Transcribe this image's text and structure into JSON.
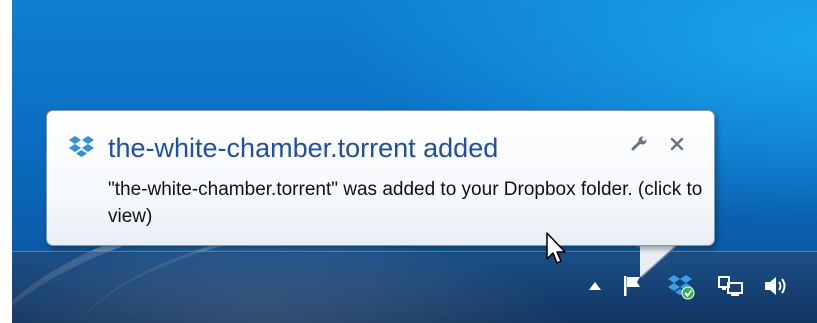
{
  "notification": {
    "app_icon": "dropbox-icon",
    "title": "the-white-chamber.torrent added",
    "body": "\"the-white-chamber.torrent\" was added to your Dropbox folder. (click to view)",
    "options_icon": "wrench-icon",
    "close_icon": "close-icon"
  },
  "system_tray": {
    "icons": [
      "show-hidden-icons-arrow-icon",
      "action-center-flag-icon",
      "dropbox-synced-icon",
      "network-icon",
      "volume-icon"
    ]
  },
  "colors": {
    "title_blue": "#1f4fa6",
    "desktop_blue": "#0b6fc3",
    "dropbox_blue": "#2f8fe0",
    "check_green": "#2fb24a"
  },
  "pointer": "arrow-cursor"
}
